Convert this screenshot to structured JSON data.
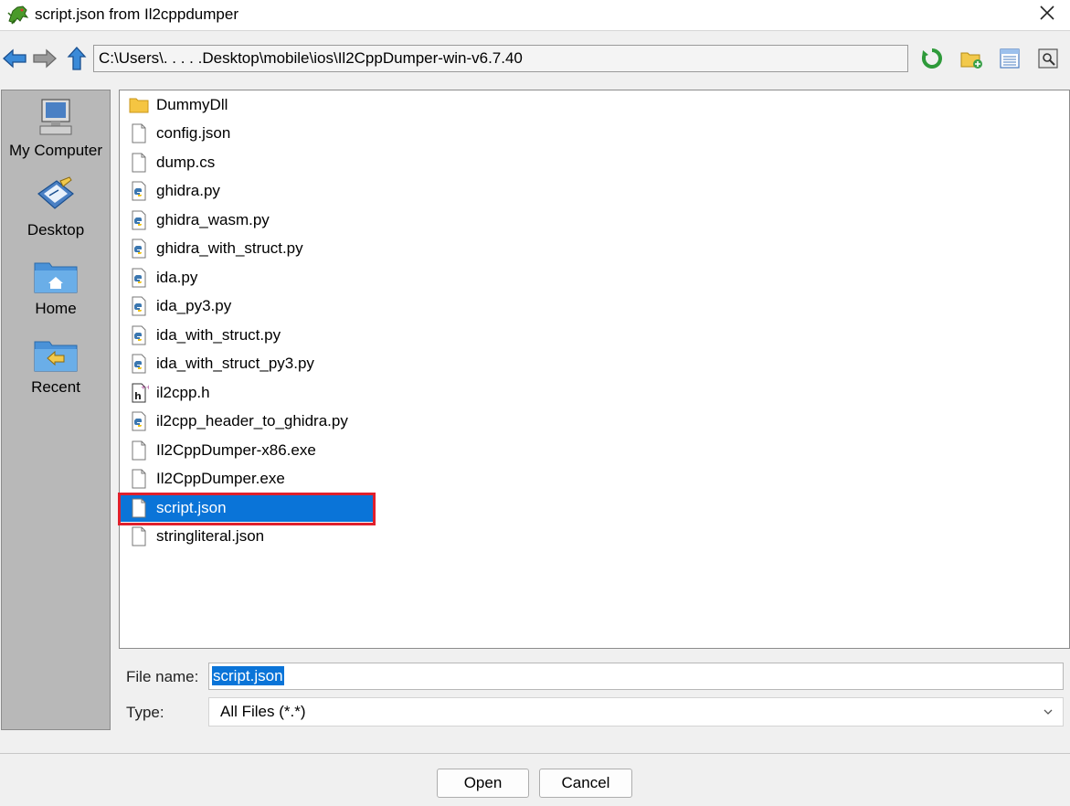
{
  "window": {
    "title": "script.json from Il2cppdumper",
    "close_glyph": "✕"
  },
  "toolbar": {
    "path": "C:\\Users\\.  .    .  . .Desktop\\mobile\\ios\\Il2CppDumper-win-v6.7.40",
    "icons": [
      "back-arrow-icon",
      "forward-arrow-icon",
      "up-arrow-icon",
      "refresh-icon",
      "new-folder-icon",
      "list-view-icon",
      "details-view-icon"
    ]
  },
  "sidebar": {
    "items": [
      {
        "label": "My Computer",
        "icon": "computer-icon"
      },
      {
        "label": "Desktop",
        "icon": "desktop-icon"
      },
      {
        "label": "Home",
        "icon": "home-folder-icon"
      },
      {
        "label": "Recent",
        "icon": "recent-folder-icon"
      }
    ]
  },
  "files": [
    {
      "name": "DummyDll",
      "type": "folder"
    },
    {
      "name": "config.json",
      "type": "file"
    },
    {
      "name": "dump.cs",
      "type": "file"
    },
    {
      "name": "ghidra.py",
      "type": "python"
    },
    {
      "name": "ghidra_wasm.py",
      "type": "python"
    },
    {
      "name": "ghidra_with_struct.py",
      "type": "python"
    },
    {
      "name": "ida.py",
      "type": "python"
    },
    {
      "name": "ida_py3.py",
      "type": "python"
    },
    {
      "name": "ida_with_struct.py",
      "type": "python"
    },
    {
      "name": "ida_with_struct_py3.py",
      "type": "python"
    },
    {
      "name": "il2cpp.h",
      "type": "header"
    },
    {
      "name": "il2cpp_header_to_ghidra.py",
      "type": "python"
    },
    {
      "name": "Il2CppDumper-x86.exe",
      "type": "file"
    },
    {
      "name": "Il2CppDumper.exe",
      "type": "file"
    },
    {
      "name": "script.json",
      "type": "file",
      "selected": true
    },
    {
      "name": "stringliteral.json",
      "type": "file"
    }
  ],
  "form": {
    "file_name_label": "File name:",
    "file_name_value": "script.json",
    "type_label": "Type:",
    "type_value": "All Files (*.*)"
  },
  "buttons": {
    "open": "Open",
    "cancel": "Cancel"
  },
  "colors": {
    "selection": "#0a74d8",
    "highlight_box": "#e0202c",
    "sidebar": "#b8b8b8"
  }
}
